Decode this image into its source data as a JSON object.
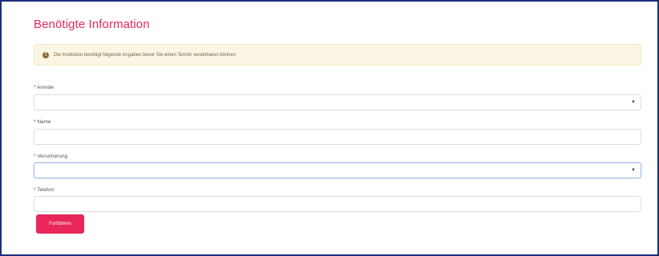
{
  "page_title": "Benötigte Information",
  "alert": {
    "icon": "info-icon",
    "text": "Die Institution benötigt folgende Angaben bevor Sie einen Termin vereinbaren können"
  },
  "fields": [
    {
      "label": "* Anrede",
      "value": "",
      "type": "select"
    },
    {
      "label": "* Name",
      "value": "",
      "type": "text"
    },
    {
      "label": "* Versicherung",
      "value": "",
      "type": "select",
      "focused": true
    },
    {
      "label": "* Telefon",
      "value": "",
      "type": "text"
    }
  ],
  "submit_label": "Fortfahren",
  "colors": {
    "accent": "#e8275a",
    "frame_border": "#1f2d7a",
    "alert_background": "#fbf6e3"
  }
}
